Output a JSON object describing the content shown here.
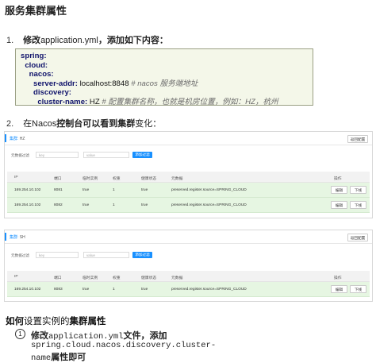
{
  "title": "服务集群属性",
  "step1": {
    "num": "1.",
    "pre": "修改",
    "mid": "application.yml",
    "post": "，添加如下内容："
  },
  "code_lines": [
    {
      "indent": "",
      "key": "spring:",
      "val": "",
      "comment": ""
    },
    {
      "indent": "  ",
      "key": "cloud:",
      "val": "",
      "comment": ""
    },
    {
      "indent": "    ",
      "key": "nacos:",
      "val": "",
      "comment": ""
    },
    {
      "indent": "      ",
      "key": "server-addr:",
      "val": " localhost:8848 ",
      "comment": "# nacos 服务端地址"
    },
    {
      "indent": "      ",
      "key": "discovery:",
      "val": "",
      "comment": ""
    },
    {
      "indent": "        ",
      "key": "cluster-name:",
      "val": " HZ ",
      "comment": "# 配置集群名称，也就是机房位置，例如：HZ，杭州"
    }
  ],
  "step2": {
    "num": "2.",
    "pre": "在Nacos",
    "mid": "控制台可以看到集群",
    "post": "变化："
  },
  "panels": [
    {
      "label": "集群:",
      "name": "HZ",
      "back": "返回配置",
      "filter_label": "元数据过滤",
      "key_ph": "key",
      "val_ph": "value",
      "add_filter": "添加过滤",
      "headers": [
        "IP",
        "端口",
        "临时实例",
        "权重",
        "健康状态",
        "元数据",
        "操作"
      ],
      "rows": [
        {
          "ip": "169.254.10.102",
          "port": "8081",
          "ephemeral": "true",
          "weight": "1",
          "healthy": "true",
          "meta": "preserved.register.source=SPRING_CLOUD",
          "edit": "编辑",
          "offline": "下线"
        },
        {
          "ip": "169.254.10.102",
          "port": "8082",
          "ephemeral": "true",
          "weight": "1",
          "healthy": "true",
          "meta": "preserved.register.source=SPRING_CLOUD",
          "edit": "编辑",
          "offline": "下线"
        }
      ]
    },
    {
      "label": "集群:",
      "name": "SH",
      "back": "返回配置",
      "filter_label": "元数据过滤",
      "key_ph": "key",
      "val_ph": "value",
      "add_filter": "添加过滤",
      "headers": [
        "IP",
        "端口",
        "临时实例",
        "权重",
        "健康状态",
        "元数据",
        "操作"
      ],
      "rows": [
        {
          "ip": "169.254.10.102",
          "port": "8083",
          "ephemeral": "true",
          "weight": "1",
          "healthy": "true",
          "meta": "preserved.register.source=SPRING_CLOUD",
          "edit": "编辑",
          "offline": "下线"
        }
      ]
    }
  ],
  "section": {
    "pre": "如何",
    "mid": "设置实例的",
    "post": "集群属性"
  },
  "instr": {
    "marker": "1",
    "l1_a": "修改",
    "l1_b": "application.yml",
    "l1_c": "文件，添加",
    "l2": "spring.cloud.nacos.discovery.cluster-",
    "l3_a": "name",
    "l3_b": "属性即可"
  }
}
